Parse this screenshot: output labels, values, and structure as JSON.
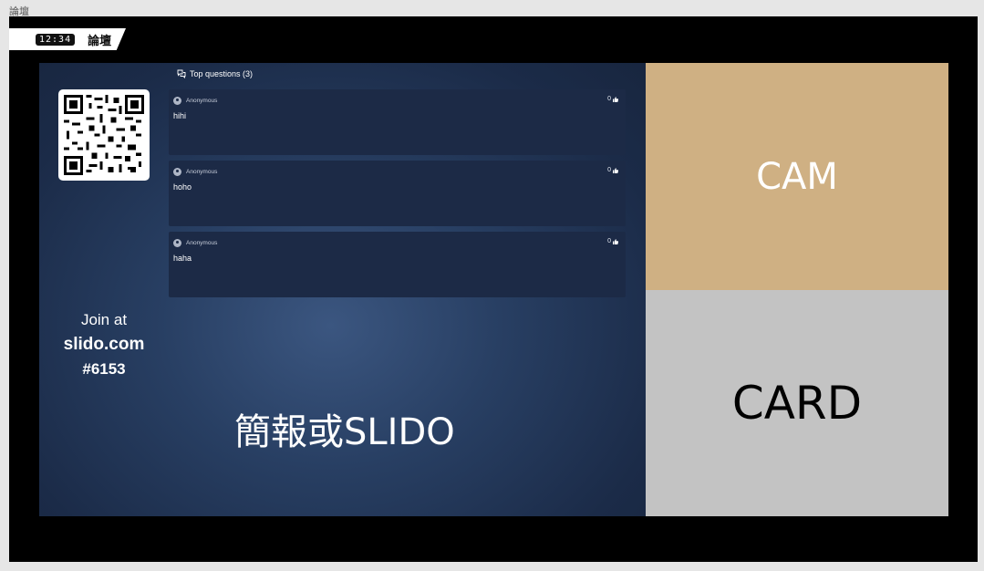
{
  "window": {
    "title": "論壇"
  },
  "top_bar": {
    "clock": "12:34",
    "section": "論壇"
  },
  "slido": {
    "questions_header": "Top questions (3)",
    "questions": [
      {
        "author": "Anonymous",
        "votes": "0",
        "text": "hihi"
      },
      {
        "author": "Anonymous",
        "votes": "0",
        "text": "hoho"
      },
      {
        "author": "Anonymous",
        "votes": "0",
        "text": "haha"
      }
    ],
    "join_at": "Join at",
    "join_url": "slido.com",
    "join_code": "#6153"
  },
  "main": {
    "caption": "簡報或SLIDO"
  },
  "cam": {
    "label": "CAM",
    "color": "#cfb083"
  },
  "card": {
    "label": "CARD",
    "color": "#c3c3c3"
  }
}
